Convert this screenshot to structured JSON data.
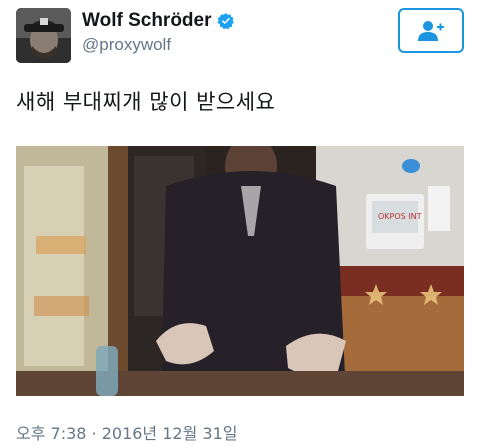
{
  "user": {
    "display_name": "Wolf Schröder",
    "handle": "@proxywolf",
    "verified": true
  },
  "icons": {
    "verified": "verified-badge-icon",
    "follow": "add-user-icon"
  },
  "colors": {
    "accent": "#1b95e0",
    "secondary_text": "#657786"
  },
  "tweet": {
    "text": "새해 부대찌개 많이 받으세요",
    "timestamp": "오후 7:38 · 2016년 12월 31일"
  },
  "media": {
    "signage_text": "OKPOS INT"
  }
}
